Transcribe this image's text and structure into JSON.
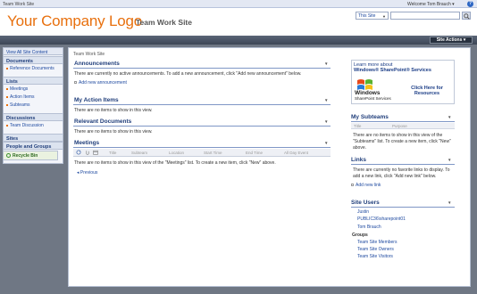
{
  "topbar": {
    "breadcrumb": "Team Work Site",
    "welcome": "Welcome Tom Brauch ▾"
  },
  "header": {
    "logo": "Your Company Logo",
    "site_title": "Team Work Site",
    "search_scope": "This Site",
    "search_placeholder": "",
    "site_actions": "Site Actions ▾"
  },
  "leftnav": {
    "view_all": "View All Site Content",
    "sections": [
      {
        "heading": "Documents",
        "items": [
          "Reference Documents"
        ]
      },
      {
        "heading": "Lists",
        "items": [
          "Meetings",
          "Action Items",
          "Subteams"
        ]
      },
      {
        "heading": "Discussions",
        "items": [
          "Team Discussion"
        ]
      },
      {
        "heading": "Sites",
        "items": []
      },
      {
        "heading": "People and Groups",
        "items": []
      }
    ],
    "recycle_bin": "Recycle Bin"
  },
  "main": {
    "breadcrumb": "Team Work Site",
    "announcements": {
      "title": "Announcements",
      "empty": "There are currently no active announcements. To add a new announcement, click \"Add new announcement\" below.",
      "add_link": "Add new announcement"
    },
    "action_items": {
      "title": "My Action Items",
      "empty": "There are no items to show in this view."
    },
    "relevant_docs": {
      "title": "Relevant Documents",
      "empty": "There are no items to show in this view."
    },
    "meetings": {
      "title": "Meetings",
      "columns": [
        "Title",
        "Subteam",
        "Location",
        "Start Time",
        "End Time",
        "All Day Event"
      ],
      "empty": "There are no items to show in this view of the \"Meetings\" list. To create a new item, click \"New\" above.",
      "previous": "Previous"
    }
  },
  "right": {
    "ad": {
      "line1": "Learn more about",
      "line2": "Windows® SharePoint® Services",
      "logo_text": "Windows",
      "logo_sub": "SharePoint Services",
      "cta": "Click Here for Resources"
    },
    "subteams": {
      "title": "My Subteams",
      "columns": [
        "Title",
        "Purpose"
      ],
      "empty": "There are no items to show in this view of the \"Subteams\" list. To create a new item, click \"New\" above."
    },
    "links": {
      "title": "Links",
      "empty": "There are currently no favorite links to display. To add a new link, click \"Add new link\" below.",
      "add_link": "Add new link"
    },
    "site_users": {
      "title": "Site Users",
      "users": [
        "Justin",
        "PUBLIC36\\sharepoint01",
        "Tom Brauch"
      ],
      "groups_heading": "Groups",
      "groups": [
        "Team Site Members",
        "Team Site Owners",
        "Team Site Visitors"
      ]
    }
  },
  "colors": {
    "logo": "#e8700e",
    "title_blue": "#1f3d7a",
    "link_blue": "#1f4aa0",
    "frame": "#6f7784"
  }
}
